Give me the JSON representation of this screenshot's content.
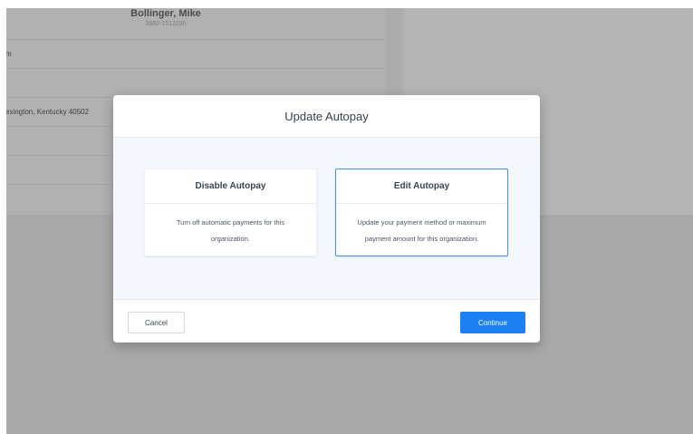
{
  "background_page": {
    "customer_name": "Bollinger, Mike",
    "customer_id": "3582-1512290",
    "rows": [
      "m",
      "",
      "exington, Kentucky 40502",
      "",
      ""
    ]
  },
  "modal": {
    "title": "Update Autopay",
    "options": [
      {
        "title": "Disable Autopay",
        "description": "Turn off automatic payments for this organization."
      },
      {
        "title": "Edit Autopay",
        "description": "Update your payment method or maximum payment amount for this organization."
      }
    ],
    "cancel_label": "Cancel",
    "continue_label": "Continue"
  },
  "colors": {
    "accent": "#1a7ff0",
    "selected_border": "#4a90e2",
    "overlay": "#a9a9a9"
  }
}
